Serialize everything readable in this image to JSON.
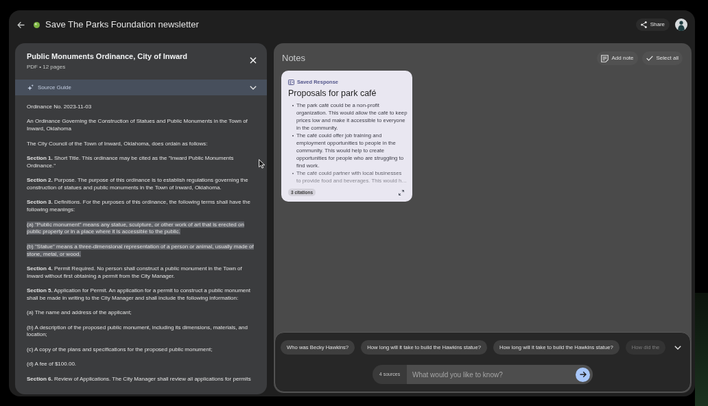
{
  "app_bar": {
    "title": "Save The Parks Foundation newsletter",
    "share": "Share"
  },
  "source": {
    "title": "Public Monuments Ordinance, City of Inward",
    "meta": "PDF • 12 pages",
    "guide": {
      "label": "Source Guide",
      "expanded": false
    },
    "paragraphs": [
      {
        "text": "Ordinance No. 2023-11-03",
        "highlighted": false
      },
      {
        "text": "An Ordinance Governing the Construction of Statues and Public Monuments in the Town of Inward, Oklahoma",
        "highlighted": false
      },
      {
        "text": "The City Council of the Town of Inward, Oklahoma, does ordain as follows:",
        "highlighted": false
      },
      {
        "text": "**Section 1.** Short Title. This ordinance may be cited as the \"Inward Public Monuments Ordinance.\"",
        "highlighted": false
      },
      {
        "text": "**Section 2.** Purpose. The purpose of this ordinance is to establish regulations governing the construction of statues and public monuments in the Town of Inward, Oklahoma.",
        "highlighted": false
      },
      {
        "text": "**Section 3.** Definitions. For the purposes of this ordinance, the following terms shall have the following meanings:",
        "highlighted": false
      },
      {
        "text": "(a) \"Public monument\" means any statue, sculpture, or other work of art that is erected on public property or in a place where it is accessible to the public.",
        "highlighted": true
      },
      {
        "text": "(b) \"Statue\" means a three-dimensional representation of a person or animal, usually made of stone, metal, or wood.",
        "highlighted": true
      },
      {
        "text": "**Section 4.** Permit Required. No person shall construct a public monument in the Town of Inward without first obtaining a permit from the City Manager.",
        "highlighted": false
      },
      {
        "text": "**Section 5.** Application for Permit. An application for a permit to construct a public monument shall be made in writing to the City Manager and shall include the following information:",
        "highlighted": false
      },
      {
        "text": "(a) The name and address of the applicant;",
        "highlighted": false
      },
      {
        "text": "(b) A description of the proposed public monument, including its dimensions, materials, and location;",
        "highlighted": false
      },
      {
        "text": "(c) A copy of the plans and specifications for the proposed public monument;",
        "highlighted": false
      },
      {
        "text": "(d) A fee of $100.00.",
        "highlighted": false
      },
      {
        "text": "**Section 6.** Review of Applications. The City Manager shall review all applications for permits",
        "highlighted": false
      }
    ]
  },
  "notes": {
    "title": "Notes",
    "actions": [
      {
        "kind": "add_note",
        "label": "Add note"
      },
      {
        "kind": "select_all",
        "label": "Select all"
      }
    ],
    "cards": [
      {
        "badge": "Saved Response",
        "title": "Proposals for park café",
        "bullets": [
          "The park café could be a non-profit organization. This would allow the café to keep prices low and make it accessible to everyone in the community.",
          "The café could offer job training and employment opportunities to people in the community. This would help to create opportunities for people who are struggling to find work.",
          "The café could partner with local businesses to provide food and beverages. This would h…"
        ],
        "citations": "3 citations"
      }
    ]
  },
  "chat": {
    "suggestions": [
      "Who was Becky Hawkins?",
      "How long will it take to build the Hawkins statue?",
      "How long will it take to build the Hawkins statue?",
      "How did the"
    ],
    "sources": "4 sources",
    "input": {
      "placeholder": "What would you like to know?"
    }
  }
}
